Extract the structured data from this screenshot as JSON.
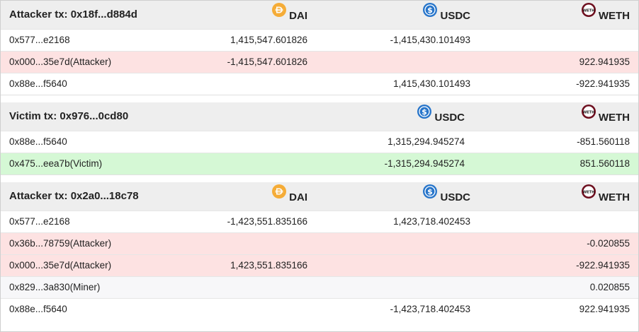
{
  "colors": {
    "dai": "#f5ac37",
    "usdc": "#2775ca",
    "weth": "#6e0f1f",
    "attacker_row": "#fde2e2",
    "victim_row": "#d5f8d5",
    "header_bg": "#eeeeee"
  },
  "tokens": {
    "dai": "DAI",
    "usdc": "USDC",
    "weth": "WETH"
  },
  "icons": {
    "dai": "dai-coin-icon",
    "usdc": "usdc-coin-icon",
    "weth": "weth-coin-icon"
  },
  "weth_icon_text": "WETH",
  "blocks": [
    {
      "title": "Attacker tx: 0x18f...d884d",
      "rows": [
        {
          "addr": "0x577...e2168",
          "dai": "1,415,547.601826",
          "usdc": "-1,415,430.101493",
          "weth": ""
        },
        {
          "addr": "0x000...35e7d(Attacker)",
          "dai": "-1,415,547.601826",
          "usdc": "",
          "weth": "922.941935"
        },
        {
          "addr": "0x88e...f5640",
          "dai": "",
          "usdc": "1,415,430.101493",
          "weth": "-922.941935"
        }
      ]
    },
    {
      "title": "Victim tx: 0x976...0cd80",
      "rows": [
        {
          "addr": "0x88e...f5640",
          "usdc": "1,315,294.945274",
          "weth": "-851.560118"
        },
        {
          "addr": "0x475...eea7b(Victim)",
          "usdc": "-1,315,294.945274",
          "weth": "851.560118"
        }
      ]
    },
    {
      "title": "Attacker tx: 0x2a0...18c78",
      "rows": [
        {
          "addr": "0x577...e2168",
          "dai": "-1,423,551.835166",
          "usdc": "1,423,718.402453",
          "weth": ""
        },
        {
          "addr": "0x36b...78759(Attacker)",
          "dai": "",
          "usdc": "",
          "weth": "-0.020855"
        },
        {
          "addr": "0x000...35e7d(Attacker)",
          "dai": "1,423,551.835166",
          "usdc": "",
          "weth": "-922.941935"
        },
        {
          "addr": "0x829...3a830(Miner)",
          "dai": "",
          "usdc": "",
          "weth": "0.020855"
        },
        {
          "addr": "0x88e...f5640",
          "dai": "",
          "usdc": "-1,423,718.402453",
          "weth": "922.941935"
        }
      ]
    }
  ]
}
